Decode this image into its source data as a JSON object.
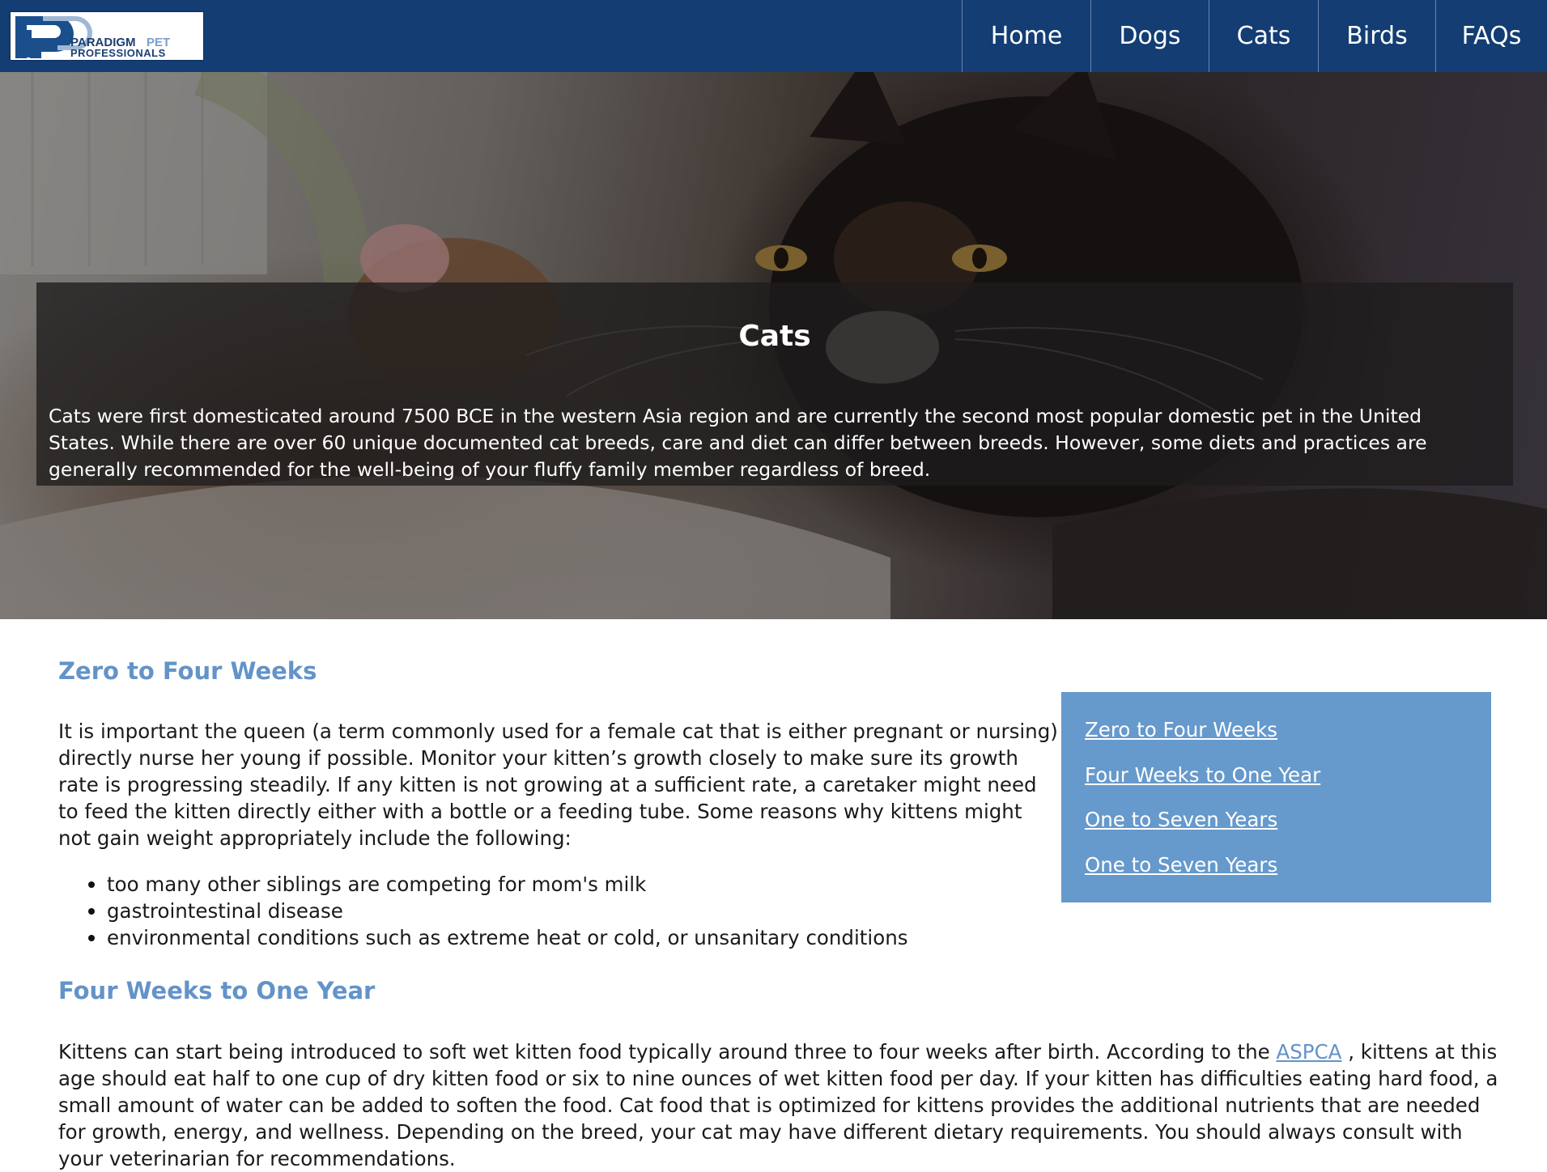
{
  "brand": {
    "logo_line1": "PARADIGM",
    "logo_line1b": "PET",
    "logo_line2": "PROFESSIONALS"
  },
  "nav": {
    "home": "Home",
    "dogs": "Dogs",
    "cats": "Cats",
    "birds": "Birds",
    "faqs": "FAQs"
  },
  "hero": {
    "title": "Cats",
    "text": "Cats were first domesticated around 7500 BCE in the western Asia region and are currently the second most popular domestic pet in the United States. While there are over 60 unique documented cat breeds, care and diet can differ between breeds. However, some diets and practices are generally recommended for the well-being of your fluffy family member regardless of breed."
  },
  "sections": {
    "zero": {
      "heading": "Zero to Four Weeks",
      "body": "It is important the queen (a term commonly used for a female cat that is either pregnant or nursing) directly nurse her young if possible. Monitor your kitten’s growth closely to make sure its growth rate is progressing steadily. If any kitten is not growing at a sufficient rate, a caretaker might need to feed the kitten directly either with a bottle or a feeding tube. Some reasons why kittens might not gain weight appropriately include the following:",
      "bullets": [
        "too many other siblings are competing for mom's milk",
        "gastrointestinal disease",
        "environmental conditions such as extreme heat or cold, or unsanitary conditions"
      ]
    },
    "four": {
      "heading": "Four Weeks to One Year",
      "body_before": "Kittens can start being introduced to soft wet kitten food typically around three to four weeks after birth. According to the ",
      "link": "ASPCA",
      "body_after": " , kittens at this age should eat half to one cup of dry kitten food or six to nine ounces of wet kitten food per day. If your kitten has difficulties eating hard food, a small amount of water can be added to soften the food. Cat food that is optimized for kittens provides the additional nutrients that are needed for growth, energy, and wellness. Depending on the breed, your cat may have different dietary requirements. You should always consult with your veterinarian for recommendations."
    }
  },
  "toc": [
    "Zero to Four Weeks",
    "Four Weeks to One Year",
    "One to Seven Years",
    "One to Seven Years"
  ],
  "colors": {
    "navbar": "#133d73",
    "accent": "#6393c8",
    "toc_bg": "#6699cc"
  }
}
